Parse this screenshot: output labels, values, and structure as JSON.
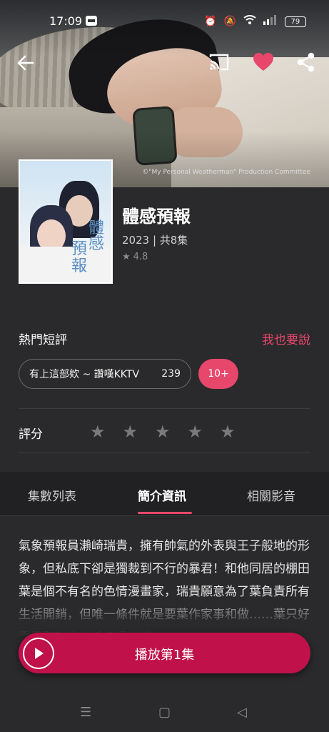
{
  "status_bar": {
    "time": "17:09",
    "battery": "79"
  },
  "hero": {
    "copyright": "©\"My Personal Weatherman\" Production Committee"
  },
  "show": {
    "title": "體感預報",
    "meta": "2023 | 共8集",
    "rating": "4.8",
    "poster_text": [
      "體",
      "感",
      "預",
      "報"
    ]
  },
  "reviews": {
    "label": "熱門短評",
    "write_link": "我也要說",
    "chip_text": "有上這部欸 ~ 讚嘆KKTV",
    "chip_count": "239",
    "more": "10+"
  },
  "rating_section": {
    "label": "評分",
    "stars": 5
  },
  "tabs": [
    {
      "label": "集數列表",
      "active": false
    },
    {
      "label": "簡介資訊",
      "active": true
    },
    {
      "label": "相關影音",
      "active": false
    }
  ],
  "synopsis": "氣象預報員瀨崎瑞貴，擁有帥氣的外表與王子般地的形象，但私底下卻是獨裁到不行的暴君！和他同居的棚田葉是個不有名的色情漫畫家，瑞貴願意為了葉負責所有生活開銷，但唯一條件就是要葉作家事和做……葉只好乖乖聽瑞貴的話任憑差遣",
  "play_button": {
    "label": "播放第1集"
  },
  "colors": {
    "accent": "#e8476c",
    "play": "#c0114a",
    "background": "#2a2a2c"
  }
}
